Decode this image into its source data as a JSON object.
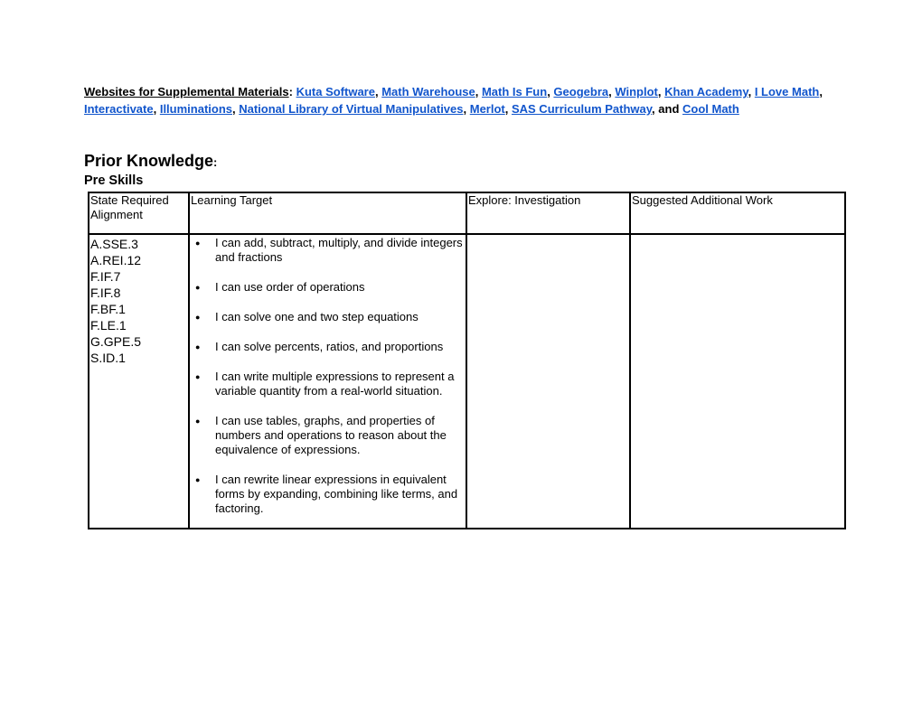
{
  "supplemental": {
    "lead": "Websites for Supplemental Materials",
    "colon": ": ",
    "links": [
      {
        "label": "Kuta Software",
        "sep": ", "
      },
      {
        "label": "Math Warehouse",
        "sep": ", "
      },
      {
        "label": "Math Is Fun",
        "sep": ", "
      },
      {
        "label": "Geogebra",
        "sep": ", "
      },
      {
        "label": "Winplot",
        "sep": ", "
      },
      {
        "label": "Khan Academy",
        "sep": ", "
      },
      {
        "label": "I Love Math",
        "sep": ", "
      },
      {
        "label": "Interactivate",
        "sep": ", "
      },
      {
        "label": "Illuminations",
        "sep": ", "
      },
      {
        "label": "National Library of Virtual Manipulatives",
        "sep": ", "
      },
      {
        "label": "Merlot",
        "sep": ", "
      },
      {
        "label": "SAS Curriculum Pathway",
        "sep": ", and "
      },
      {
        "label": "Cool Math",
        "sep": ""
      }
    ]
  },
  "prior_knowledge": {
    "heading": "Prior Knowledge",
    "colon": ":",
    "subheading": "Pre Skills"
  },
  "table": {
    "headers": [
      "State Required Alignment",
      "Learning Target",
      "Explore: Investigation",
      "Suggested Additional Work"
    ],
    "standards": [
      "A.SSE.3",
      "A.REI.12",
      "F.IF.7",
      "F.IF.8",
      "F.BF.1",
      "F.LE.1",
      "G.GPE.5",
      "S.ID.1"
    ],
    "learning_targets": [
      "I can add, subtract, multiply, and divide integers and fractions",
      "I can use order of operations",
      "I can solve one and two step equations",
      "I can solve percents, ratios, and proportions",
      "I can write multiple expressions to represent a variable quantity from a real-world situation.",
      "I can use tables, graphs, and properties of numbers and operations to reason about the equivalence of expressions.",
      "I can rewrite linear expressions in equivalent forms by expanding, combining like terms, and factoring."
    ],
    "explore": "",
    "additional_work": ""
  }
}
